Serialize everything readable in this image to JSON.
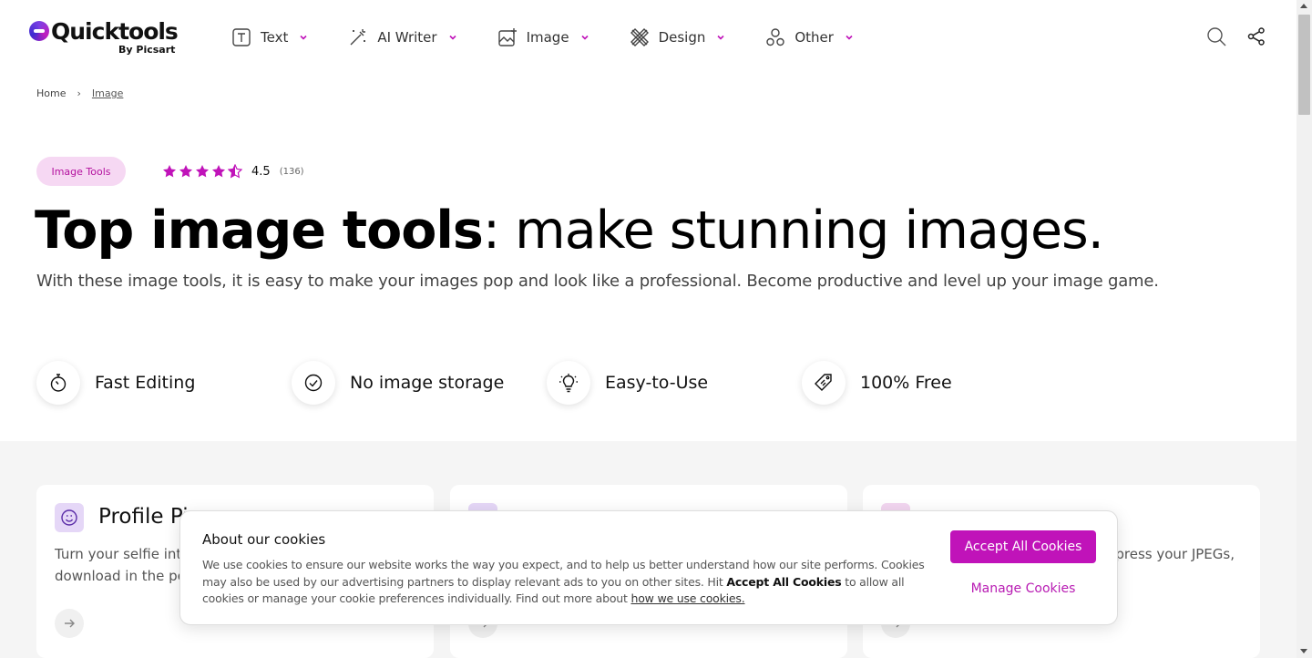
{
  "brand": {
    "name": "Quicktools",
    "byline": "By Picsart",
    "accent_color": "#c013b9",
    "badge_bg": "#f6d8f3"
  },
  "nav": {
    "items": [
      {
        "label": "Text",
        "icon": "text-box-icon"
      },
      {
        "label": "AI Writer",
        "icon": "magic-wand-icon"
      },
      {
        "label": "Image",
        "icon": "image-icon"
      },
      {
        "label": "Design",
        "icon": "design-tools-icon"
      },
      {
        "label": "Other",
        "icon": "shapes-icon"
      }
    ],
    "search_icon": "search-icon",
    "share_icon": "share-icon"
  },
  "breadcrumb": {
    "home": "Home",
    "separator": "›",
    "current": "Image"
  },
  "hero": {
    "badge": "Image Tools",
    "rating": {
      "value": "4.5",
      "count": "(136)",
      "stars": 4.5
    },
    "title_bold": "Top image tools",
    "title_rest": ": make stunning images.",
    "subtitle": "With these image tools, it is easy to make your images pop and look like a professional. Become productive and level up your image game."
  },
  "features": [
    {
      "label": "Fast Editing",
      "icon": "stopwatch-icon"
    },
    {
      "label": "No image storage",
      "icon": "check-circle-icon"
    },
    {
      "label": "Easy-to-Use",
      "icon": "lightbulb-icon"
    },
    {
      "label": "100% Free",
      "icon": "price-tag-icon"
    }
  ],
  "cards": [
    {
      "title": "Profile Pi",
      "desc": "Turn your selfie into",
      "desc2": "download in the pe"
    },
    {
      "title": "",
      "desc": "",
      "desc2": ""
    },
    {
      "title": "",
      "desc": "press your JPEGs,",
      "desc2": ""
    }
  ],
  "cookie": {
    "title": "About our cookies",
    "text_1": "We use cookies to ensure our website works the way you expect, and to help us better understand how our site performs. Cookies may also be used by our advertising partners to display relevant ads to you on other sites. Hit ",
    "text_bold": "Accept All Cookies",
    "text_2": " to allow all cookies or manage your cookie preferences individually. Find out more about ",
    "link": "how we use cookies.",
    "accept_label": "Accept All Cookies",
    "manage_label": "Manage Cookies"
  }
}
